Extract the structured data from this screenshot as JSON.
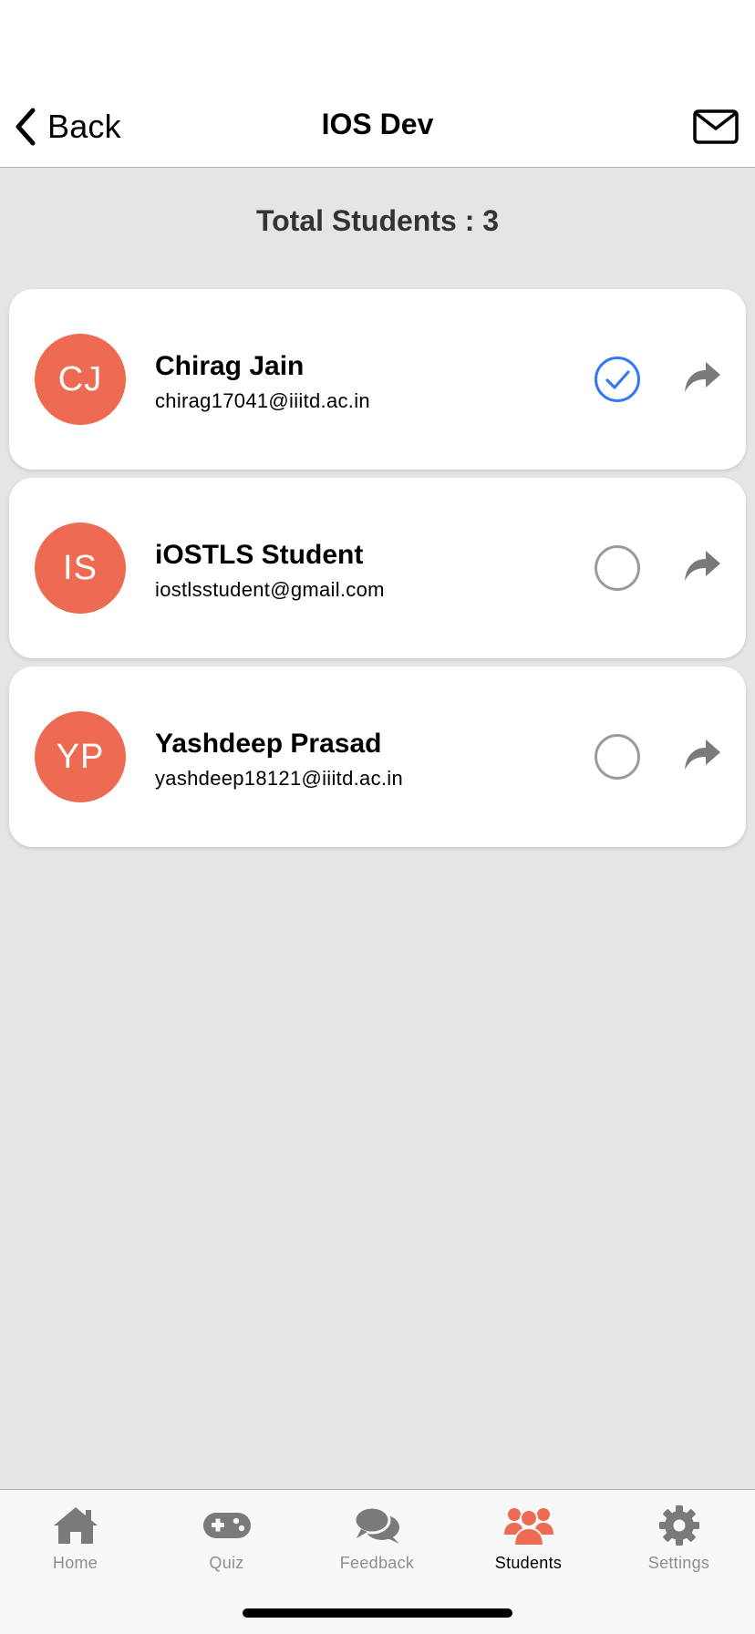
{
  "nav": {
    "back_label": "Back",
    "title": "IOS Dev"
  },
  "summary": {
    "total_label": "Total Students : 3"
  },
  "students": [
    {
      "initials": "CJ",
      "name": "Chirag Jain",
      "email": "chirag17041@iiitd.ac.in",
      "selected": true
    },
    {
      "initials": "IS",
      "name": "iOSTLS Student",
      "email": "iostlsstudent@gmail.com",
      "selected": false
    },
    {
      "initials": "YP",
      "name": "Yashdeep Prasad",
      "email": "yashdeep18121@iiitd.ac.in",
      "selected": false
    }
  ],
  "tabs": [
    {
      "label": "Home",
      "icon": "home-icon",
      "active": false
    },
    {
      "label": "Quiz",
      "icon": "gamepad-icon",
      "active": false
    },
    {
      "label": "Feedback",
      "icon": "chat-bubbles-icon",
      "active": false
    },
    {
      "label": "Students",
      "icon": "users-icon",
      "active": true
    },
    {
      "label": "Settings",
      "icon": "gear-icon",
      "active": false
    }
  ],
  "colors": {
    "accent": "#ee6b53",
    "selected": "#3478f6",
    "unselected": "#9b9b9b",
    "icon_gray": "#7a7a7a",
    "background": "#e5e5e5"
  }
}
